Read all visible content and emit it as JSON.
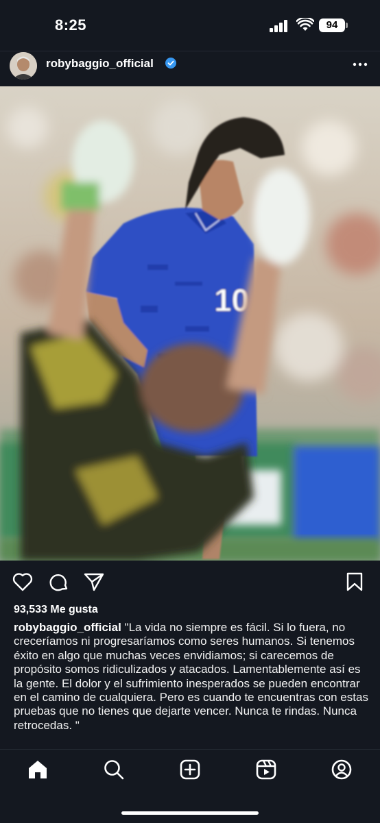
{
  "status": {
    "time": "8:25",
    "battery": "94"
  },
  "post": {
    "username": "robybaggio_official",
    "likes": "93,533 Me gusta",
    "caption_user": "robybaggio_official",
    "caption_text": "\"La vida no siempre es fácil. Si lo fuera, no creceríamos ni progresaríamos como seres humanos. Si tenemos éxito en algo que muchas veces envidiamos; si carecemos de propósito somos ridiculizados y atacados. Lamentablemente así es la gente. El dolor y el sufrimiento inesperados se pueden encontrar en el camino de cualquiera. Pero es cuando te encuentras con estas pruebas que no tienes que dejarte vencer. Nunca te rindas. Nunca retrocedas. \"",
    "jersey_number": "10"
  },
  "icons": {
    "header": [
      "avatar",
      "verified-badge-icon",
      "more-options-icon"
    ],
    "actions": [
      "heart-icon",
      "comment-icon",
      "share-icon",
      "bookmark-icon"
    ],
    "tabs": [
      "home-icon",
      "search-icon",
      "create-icon",
      "reels-icon",
      "profile-icon"
    ]
  },
  "colors": {
    "background": "#141820",
    "verified": "#3797f0",
    "jersey": "#2f4fc4"
  }
}
